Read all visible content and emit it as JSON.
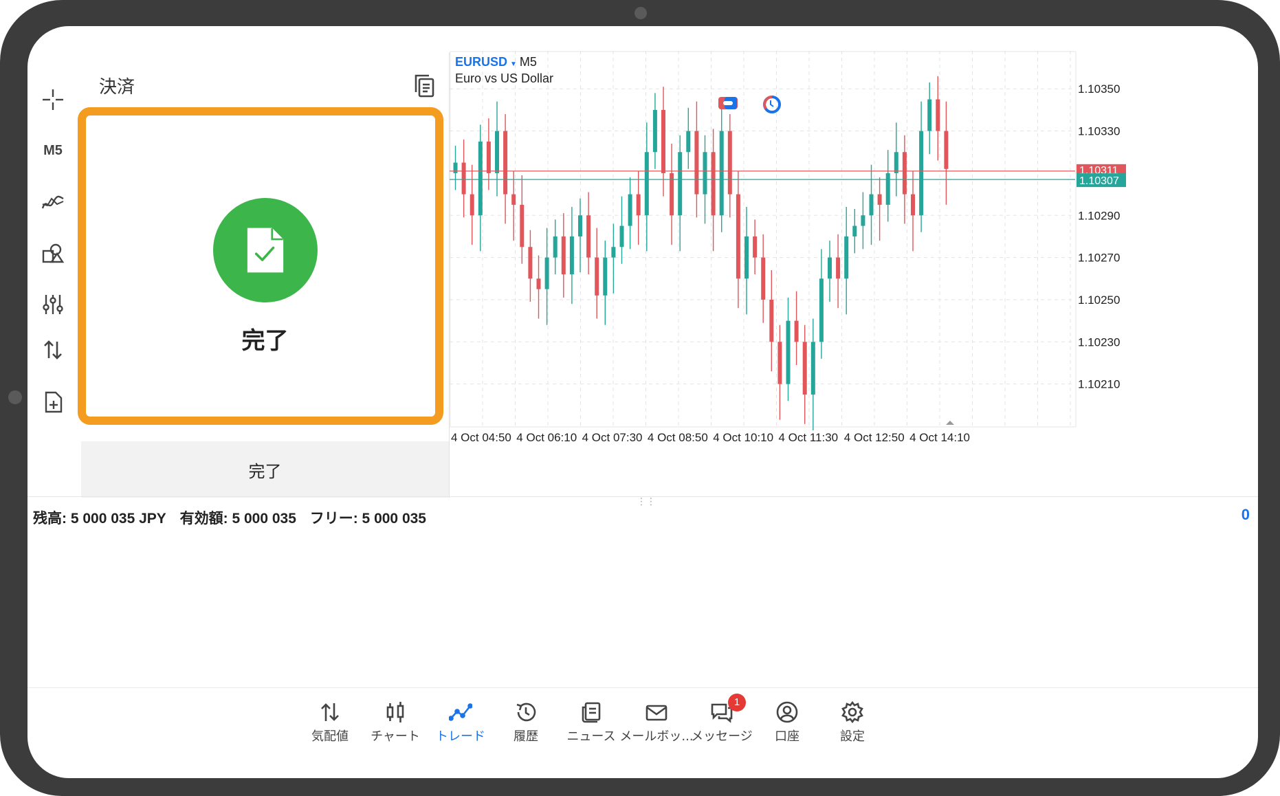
{
  "panel": {
    "title": "決済",
    "done_label": "完了",
    "done_button": "完了"
  },
  "toolbar": {
    "timeframe": "M5"
  },
  "chart": {
    "symbol": "EURUSD",
    "timeframe": "M5",
    "description": "Euro vs US Dollar",
    "bid_price": "1.10307",
    "ask_price": "1.10311",
    "price_labels": [
      "1.10350",
      "1.10330",
      "1.10290",
      "1.10270",
      "1.10250",
      "1.10230",
      "1.10210"
    ],
    "time_labels": [
      "4 Oct 04:50",
      "4 Oct 06:10",
      "4 Oct 07:30",
      "4 Oct 08:50",
      "4 Oct 10:10",
      "4 Oct 11:30",
      "4 Oct 12:50",
      "4 Oct 14:10"
    ],
    "up_color": "#26a69a",
    "down_color": "#e0565b"
  },
  "account": {
    "balance": "残高:  5 000 035 JPY",
    "equity": "有効額:  5 000 035",
    "free": "フリー:  5 000 035",
    "positions_count": "0"
  },
  "nav": [
    {
      "label": "気配値",
      "icon": "quotes-icon"
    },
    {
      "label": "チャート",
      "icon": "chart-icon"
    },
    {
      "label": "トレード",
      "icon": "trade-icon",
      "active": true
    },
    {
      "label": "履歴",
      "icon": "history-icon"
    },
    {
      "label": "ニュース",
      "icon": "news-icon"
    },
    {
      "label": "メールボッ...",
      "icon": "mail-icon"
    },
    {
      "label": "メッセージ",
      "icon": "messages-icon",
      "badge": "1"
    },
    {
      "label": "口座",
      "icon": "account-icon"
    },
    {
      "label": "設定",
      "icon": "settings-icon"
    }
  ]
}
